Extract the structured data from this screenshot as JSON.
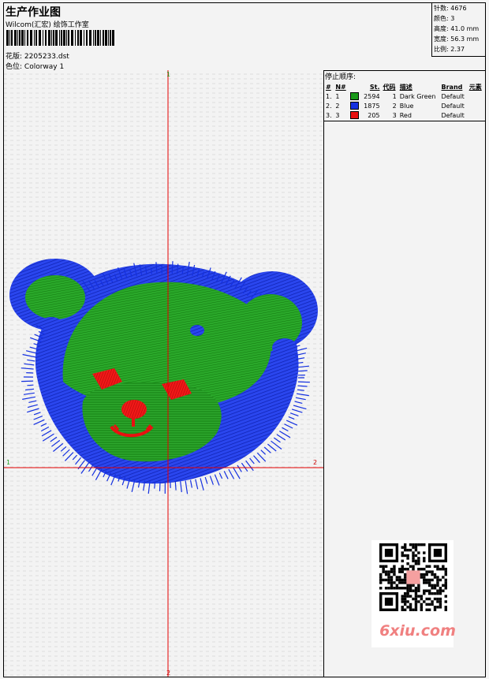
{
  "header": {
    "title": "生产作业图",
    "company": "Wilcom(汇宏) 绘饰工作室",
    "filename_label": "花版:",
    "filename": "2205233.dst",
    "colorway_label": "色位:",
    "colorway": "Colorway 1"
  },
  "stats": [
    {
      "label": "针数:",
      "value": "4676"
    },
    {
      "label": "颜色:",
      "value": "3"
    },
    {
      "label": "高度:",
      "value": "41.0 mm"
    },
    {
      "label": "宽度:",
      "value": "56.3 mm"
    },
    {
      "label": "比例:",
      "value": "2.37"
    }
  ],
  "stop_sequence": {
    "title": "停止顺序:",
    "columns": [
      "#",
      "N#",
      "St.",
      "代码",
      "描述",
      "Brand",
      "元素"
    ],
    "rows": [
      {
        "num": "1.",
        "n": "1",
        "color": "#1a9a1a",
        "st": "2594",
        "code": "1",
        "desc": "Dark Green",
        "brand": "Default",
        "elem": ""
      },
      {
        "num": "2.",
        "n": "2",
        "color": "#1430e0",
        "st": "1875",
        "code": "2",
        "desc": "Blue",
        "brand": "Default",
        "elem": ""
      },
      {
        "num": "3.",
        "n": "3",
        "color": "#e81010",
        "st": "205",
        "code": "3",
        "desc": "Red",
        "brand": "Default",
        "elem": ""
      }
    ]
  },
  "axes": {
    "top": "1",
    "bottom": "2",
    "left": "1",
    "right": "2"
  },
  "watermark": "6xiu.com",
  "colors": {
    "axis": "#e60000",
    "green": "#1a9a1a",
    "blue": "#1430e0",
    "red": "#e81010"
  }
}
